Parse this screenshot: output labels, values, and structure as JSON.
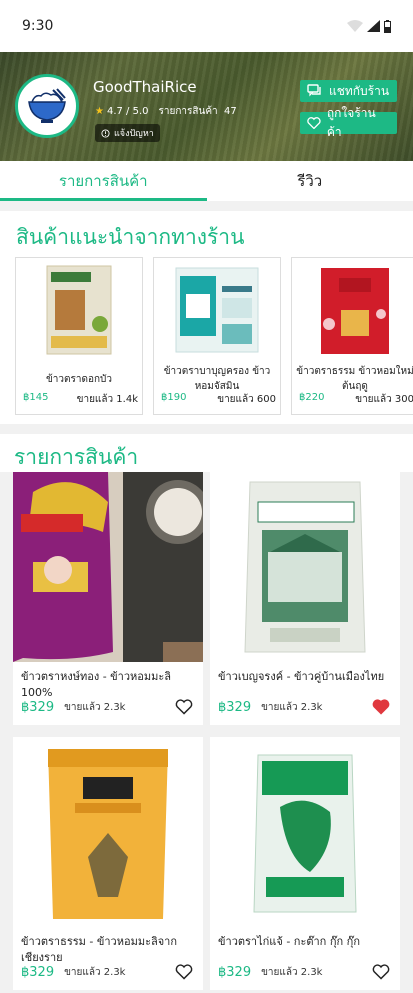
{
  "status_bar": {
    "time": "9:30"
  },
  "shop": {
    "name": "GoodThaiRice",
    "rating": "4.7 / 5.0",
    "products_label": "รายการสินค้า",
    "products_count": "47",
    "report_label": "แจ้งปัญหา",
    "chat_label": "แชทกับร้าน",
    "follow_label": "ถูกใจร้านค้า"
  },
  "tabs": [
    {
      "label": "รายการสินค้า",
      "active": true
    },
    {
      "label": "รีวิว",
      "active": false
    }
  ],
  "recommended": {
    "title": "สินค้าแนะนำจากทางร้าน",
    "items": [
      {
        "name": "ข้าวตราดอกบัว",
        "price": "฿145",
        "sold": "ขายแล้ว 1.4k"
      },
      {
        "name": "ข้าวตราบาบุญครอง ข้าวหอมจัสมิน",
        "price": "฿190",
        "sold": "ขายแล้ว 600"
      },
      {
        "name": "ข้าวตราธรรม ข้าวหอมใหม่ต้นฤดู",
        "price": "฿220",
        "sold": "ขายแล้ว 300"
      }
    ]
  },
  "products": {
    "title": "รายการสินค้า",
    "items": [
      {
        "name": "ข้าวตราหงษ์ทอง - ข้าวหอมมะลิ 100%",
        "price": "฿329",
        "sold": "ขายแล้ว 2.3k",
        "liked": false
      },
      {
        "name": "ข้าวเบญจรงค์ - ข้าวคู่บ้านเมืองไทย",
        "price": "฿329",
        "sold": "ขายแล้ว 2.3k",
        "liked": true
      },
      {
        "name": "ข้าวตราธรรม - ข้าวหอมมะลิจากเชียงราย",
        "price": "฿329",
        "sold": "ขายแล้ว 2.3k",
        "liked": false
      },
      {
        "name": "ข้าวตราไก่แจ้ - กะต๊าก กุ๊ก กุ๊ก",
        "price": "฿329",
        "sold": "ขายแล้ว 2.3k",
        "liked": false
      }
    ]
  },
  "colors": {
    "accent": "#1db985",
    "liked": "#e0383e"
  }
}
